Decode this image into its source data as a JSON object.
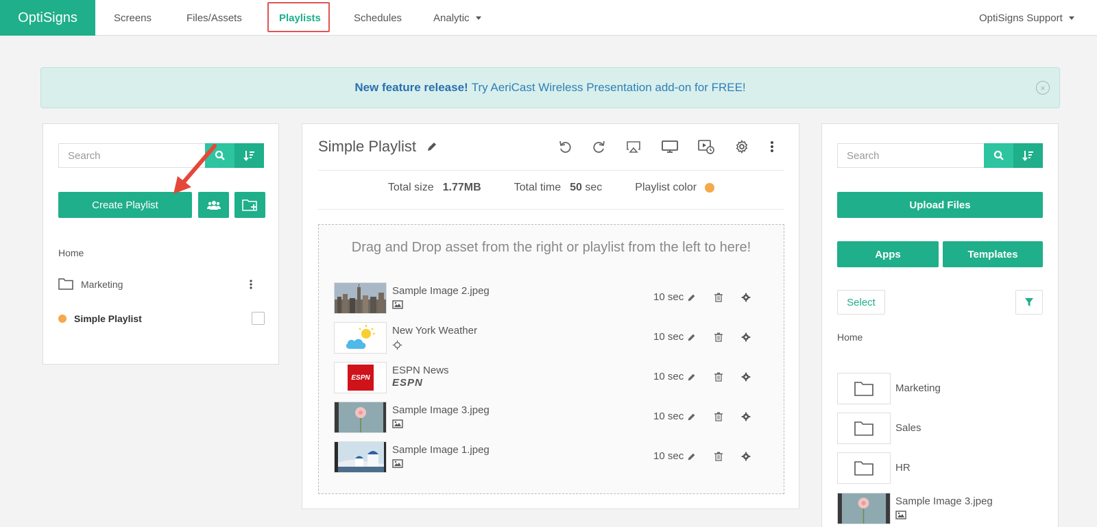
{
  "nav": {
    "brand": "OptiSigns",
    "items": [
      {
        "label": "Screens"
      },
      {
        "label": "Files/Assets"
      },
      {
        "label": "Playlists"
      },
      {
        "label": "Schedules"
      },
      {
        "label": "Analytic"
      }
    ],
    "user": "OptiSigns Support"
  },
  "banner": {
    "bold": "New feature release!",
    "text": "Try AeriCast Wireless Presentation add-on for FREE!"
  },
  "left": {
    "search_placeholder": "Search",
    "create_label": "Create Playlist",
    "breadcrumb": "Home",
    "folders": [
      {
        "name": "Marketing"
      }
    ],
    "playlists": [
      {
        "name": "Simple Playlist",
        "color": "#f5a94a"
      }
    ]
  },
  "center": {
    "title": "Simple Playlist",
    "total_size_label": "Total size",
    "total_size": "1.77MB",
    "total_time_label": "Total time",
    "total_time_value": "50",
    "total_time_unit": "sec",
    "color_label": "Playlist color",
    "drop_text": "Drag and Drop asset from the right or playlist from the left to here!",
    "items": [
      {
        "name": "Sample Image 2.jpeg",
        "duration": "10 sec",
        "type_icon": "image-icon"
      },
      {
        "name": "New York Weather",
        "duration": "10 sec",
        "type_icon": "app-icon"
      },
      {
        "name": "ESPN News",
        "duration": "10 sec",
        "type_icon": "espn-logo"
      },
      {
        "name": "Sample Image 3.jpeg",
        "duration": "10 sec",
        "type_icon": "image-icon"
      },
      {
        "name": "Sample Image 1.jpeg",
        "duration": "10 sec",
        "type_icon": "image-icon"
      }
    ],
    "espn_thumb_text": "ESPN",
    "espn_logo_text": "ESPN"
  },
  "right": {
    "search_placeholder": "Search",
    "upload_label": "Upload Files",
    "apps_label": "Apps",
    "templates_label": "Templates",
    "select_label": "Select",
    "breadcrumb": "Home",
    "folders": [
      {
        "name": "Marketing"
      },
      {
        "name": "Sales"
      },
      {
        "name": "HR"
      }
    ],
    "files": [
      {
        "name": "Sample Image 3.jpeg"
      }
    ]
  },
  "colors": {
    "accent": "#1faf8a",
    "banner_bg": "#d9efec",
    "highlight": "#e05353",
    "playlist_dot": "#f5a94a"
  }
}
